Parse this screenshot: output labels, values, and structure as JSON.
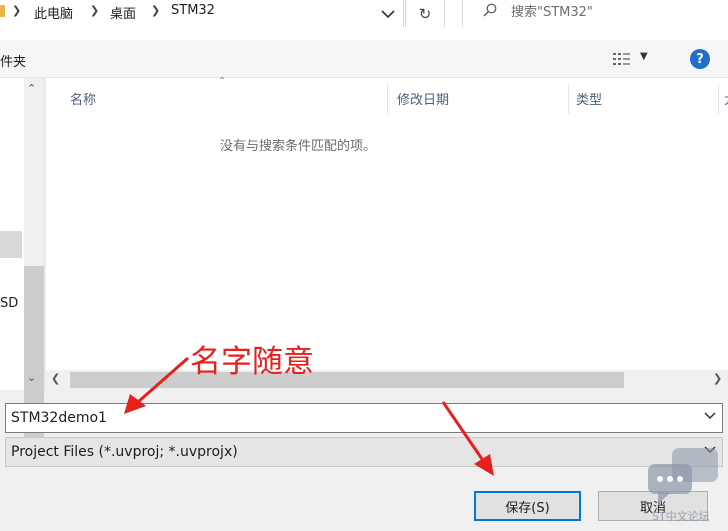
{
  "address_bar": {
    "crumbs": [
      "此电脑",
      "桌面",
      "STM32"
    ],
    "search_placeholder": "搜索\"STM32\""
  },
  "command_bar": {
    "new_folder": "件夹",
    "help": "?"
  },
  "nav_pane": {
    "visible_item": "SD"
  },
  "file_list": {
    "columns": [
      "名称",
      "修改日期",
      "类型",
      "大"
    ],
    "empty_message": "没有与搜索条件匹配的项。"
  },
  "form": {
    "filename_value": "STM32demo1",
    "filetype_value": "Project Files (*.uvproj; *.uvprojx)"
  },
  "buttons": {
    "save": "保存(S)",
    "cancel": "取消"
  },
  "annotation": {
    "text": "名字随意",
    "color": "#e5201d"
  },
  "watermark": {
    "text": "ST中文论坛"
  },
  "colors": {
    "accent": "#0078d7",
    "help": "#1f6fc9",
    "folder": "#e8b745"
  }
}
